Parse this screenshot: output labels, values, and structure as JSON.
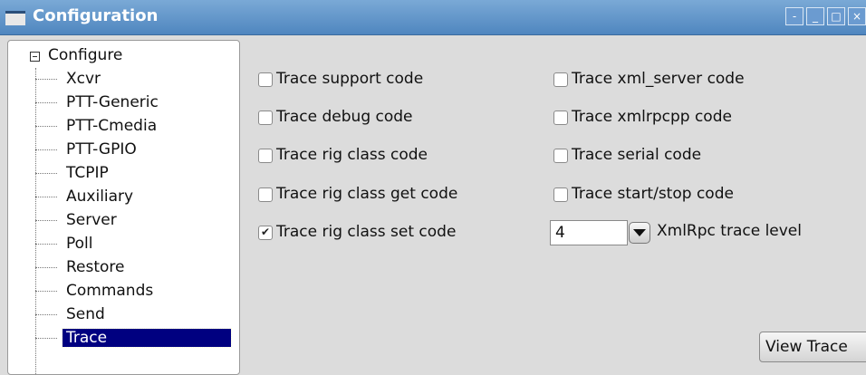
{
  "window": {
    "title": "Configuration",
    "buttons": [
      "-",
      "_",
      "□",
      "×"
    ]
  },
  "tree": {
    "root_label": "Configure",
    "items": [
      {
        "label": "Xcvr",
        "selected": false
      },
      {
        "label": "PTT-Generic",
        "selected": false
      },
      {
        "label": "PTT-Cmedia",
        "selected": false
      },
      {
        "label": "PTT-GPIO",
        "selected": false
      },
      {
        "label": "TCPIP",
        "selected": false
      },
      {
        "label": "Auxiliary",
        "selected": false
      },
      {
        "label": "Server",
        "selected": false
      },
      {
        "label": "Poll",
        "selected": false
      },
      {
        "label": "Restore",
        "selected": false
      },
      {
        "label": "Commands",
        "selected": false
      },
      {
        "label": "Send",
        "selected": false
      },
      {
        "label": "Trace",
        "selected": true
      }
    ]
  },
  "options": {
    "left": [
      {
        "label": "Trace support code",
        "checked": false
      },
      {
        "label": "Trace debug code",
        "checked": false
      },
      {
        "label": "Trace rig class code",
        "checked": false
      },
      {
        "label": "Trace rig class get code",
        "checked": false
      },
      {
        "label": "Trace rig class set code",
        "checked": true
      }
    ],
    "right": [
      {
        "label": "Trace xml_server code",
        "checked": false
      },
      {
        "label": "Trace xmlrpcpp code",
        "checked": false
      },
      {
        "label": "Trace serial code",
        "checked": false
      },
      {
        "label": "Trace start/stop code",
        "checked": false
      }
    ]
  },
  "xmlrpc_level": {
    "value": "4",
    "label": "XmlRpc trace level"
  },
  "view_trace_button": "View Trace"
}
